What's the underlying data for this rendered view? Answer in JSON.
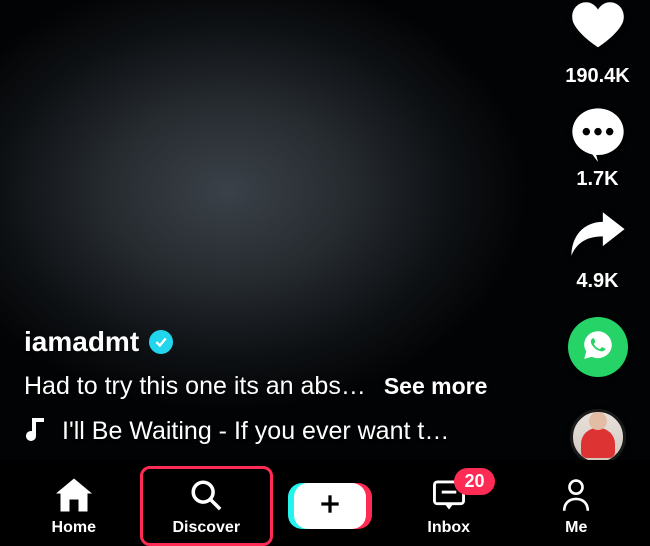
{
  "post": {
    "username": "iamadmt",
    "verified": true,
    "caption_truncated": "Had to try this one its an abs…",
    "see_more_label": "See more",
    "sound_text": "I'll Be Waiting - If you ever want t…"
  },
  "actions": {
    "like_count": "190.4K",
    "comment_count": "1.7K",
    "share_count": "4.9K"
  },
  "nav": {
    "home": "Home",
    "discover": "Discover",
    "inbox": "Inbox",
    "inbox_badge": "20",
    "me": "Me"
  }
}
